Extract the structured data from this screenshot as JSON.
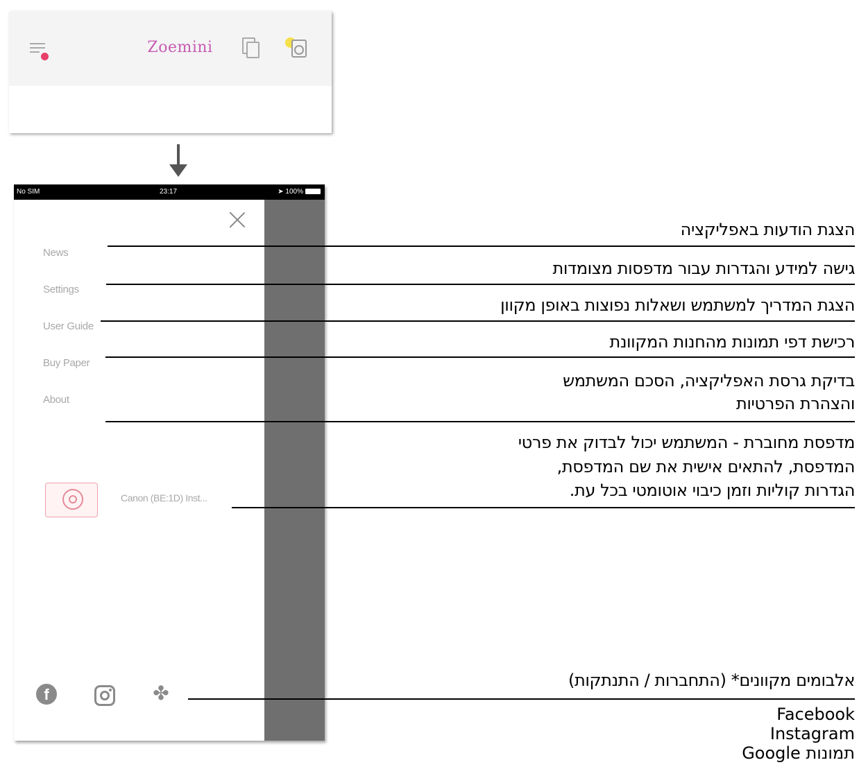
{
  "header": {
    "brand": "Zoemini",
    "icons": [
      "menu-icon",
      "copy-icon",
      "printer-icon"
    ],
    "notification_dot_color": "#e83e6a",
    "brand_color": "#c75bb3"
  },
  "status_bar": {
    "carrier": "No SIM",
    "time": "23:17",
    "battery": "100%"
  },
  "menu": {
    "items": [
      {
        "label": "News"
      },
      {
        "label": "Settings"
      },
      {
        "label": "User Guide"
      },
      {
        "label": "Buy Paper"
      },
      {
        "label": "About"
      }
    ],
    "printer_name": "Canon (BE:1D) Inst...",
    "social_icons": [
      "facebook-icon",
      "instagram-icon",
      "google-photos-icon"
    ]
  },
  "callouts": {
    "news": "הצגת הודעות באפליקציה",
    "settings": "גישה למידע והגדרות עבור מדפסות מצומדות",
    "user_guide": "הצגת המדריך למשתמש ושאלות נפוצות באופן מקוון",
    "buy_paper": "רכישת דפי תמונות מהחנות המקוונת",
    "about_line1": "בדיקת גרסת האפליקציה, הסכם המשתמש",
    "about_line2": "והצהרת הפרטיות",
    "printer_line1": "מדפסת מחוברת - המשתמש יכול לבדוק את פרטי",
    "printer_line2": "המדפסת, להתאים אישית את שם המדפסת,",
    "printer_line3": "הגדרות קוליות וזמן כיבוי אוטומטי בכל עת.",
    "albums": "אלבומים מקוונים* (התחברות / התנתקות)",
    "albums_list": [
      "Facebook",
      "Instagram",
      "תמונות Google"
    ]
  }
}
